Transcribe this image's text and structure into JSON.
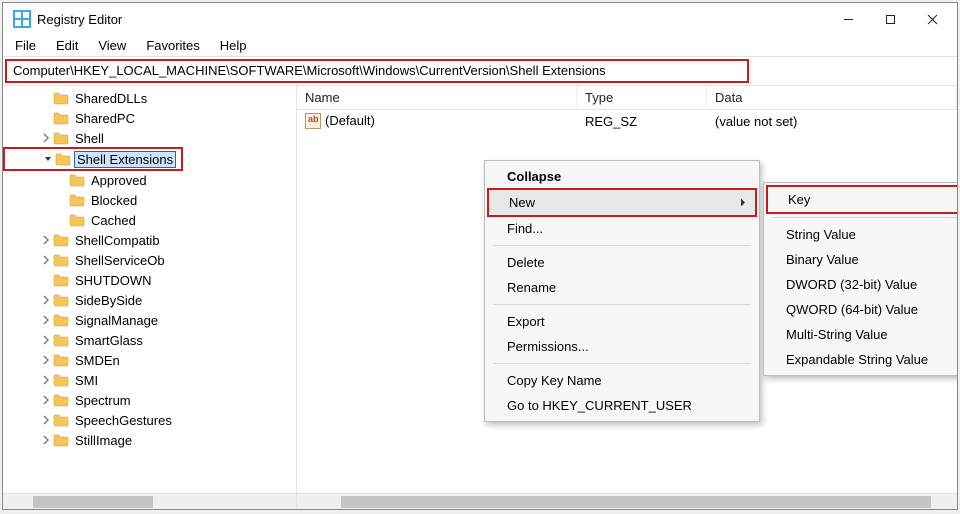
{
  "window": {
    "title": "Registry Editor"
  },
  "menubar": [
    "File",
    "Edit",
    "View",
    "Favorites",
    "Help"
  ],
  "address": "Computer\\HKEY_LOCAL_MACHINE\\SOFTWARE\\Microsoft\\Windows\\CurrentVersion\\Shell Extensions",
  "tree": [
    {
      "indent": 2,
      "expander": "",
      "label": "SharedDLLs"
    },
    {
      "indent": 2,
      "expander": "",
      "label": "SharedPC"
    },
    {
      "indent": 2,
      "expander": "right",
      "label": "Shell"
    },
    {
      "indent": 2,
      "expander": "down",
      "label": "Shell Extensions",
      "selected": true,
      "highlight": true
    },
    {
      "indent": 3,
      "expander": "",
      "label": "Approved"
    },
    {
      "indent": 3,
      "expander": "",
      "label": "Blocked"
    },
    {
      "indent": 3,
      "expander": "",
      "label": "Cached"
    },
    {
      "indent": 2,
      "expander": "right",
      "label": "ShellCompatib"
    },
    {
      "indent": 2,
      "expander": "right",
      "label": "ShellServiceOb"
    },
    {
      "indent": 2,
      "expander": "",
      "label": "SHUTDOWN"
    },
    {
      "indent": 2,
      "expander": "right",
      "label": "SideBySide"
    },
    {
      "indent": 2,
      "expander": "right",
      "label": "SignalManage"
    },
    {
      "indent": 2,
      "expander": "right",
      "label": "SmartGlass"
    },
    {
      "indent": 2,
      "expander": "right",
      "label": "SMDEn"
    },
    {
      "indent": 2,
      "expander": "right",
      "label": "SMI"
    },
    {
      "indent": 2,
      "expander": "right",
      "label": "Spectrum"
    },
    {
      "indent": 2,
      "expander": "right",
      "label": "SpeechGestures"
    },
    {
      "indent": 2,
      "expander": "right",
      "label": "StillImage"
    }
  ],
  "list": {
    "headers": {
      "name": "Name",
      "type": "Type",
      "data": "Data"
    },
    "rows": [
      {
        "name": "(Default)",
        "type": "REG_SZ",
        "data": "(value not set)"
      }
    ]
  },
  "context_menu_1": {
    "items": [
      {
        "label": "Collapse",
        "bold": true
      },
      {
        "label": "New",
        "submenu": true,
        "hover": true,
        "highlight": true
      },
      {
        "label": "Find..."
      },
      {
        "sep": true
      },
      {
        "label": "Delete"
      },
      {
        "label": "Rename"
      },
      {
        "sep": true
      },
      {
        "label": "Export"
      },
      {
        "label": "Permissions..."
      },
      {
        "sep": true
      },
      {
        "label": "Copy Key Name"
      },
      {
        "label": "Go to HKEY_CURRENT_USER"
      }
    ]
  },
  "context_menu_2": {
    "items": [
      {
        "label": "Key",
        "highlight": true
      },
      {
        "sep": true
      },
      {
        "label": "String Value"
      },
      {
        "label": "Binary Value"
      },
      {
        "label": "DWORD (32-bit) Value"
      },
      {
        "label": "QWORD (64-bit) Value"
      },
      {
        "label": "Multi-String Value"
      },
      {
        "label": "Expandable String Value"
      }
    ]
  }
}
